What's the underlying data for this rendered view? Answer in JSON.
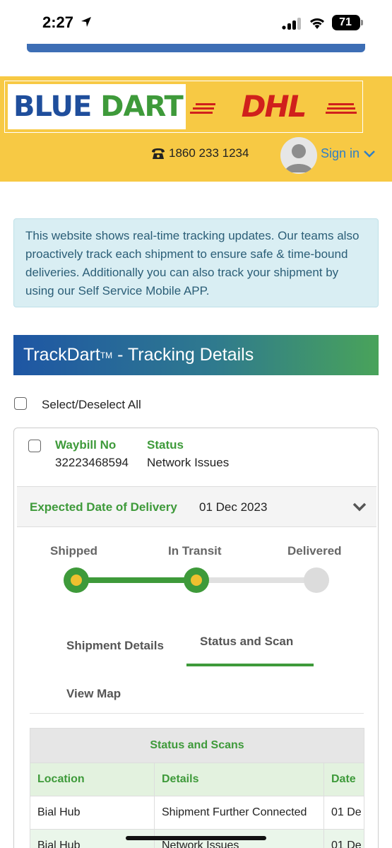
{
  "status_bar": {
    "time": "2:27",
    "battery": "71"
  },
  "header": {
    "logo_blue": "BLUE",
    "logo_dart": "DART",
    "logo_dhl": "DHL",
    "phone": "1860 233 1234",
    "signin": "Sign in"
  },
  "alert": {
    "text": "This website shows real-time tracking updates. Our teams also proactively track each shipment to ensure safe & time-bound deliveries. Additionally you can also track your shipment by using our Self Service Mobile APP."
  },
  "tracking": {
    "title": "TrackDart",
    "tm": "TM",
    "title_suffix": " - Tracking Details",
    "select_all": "Select/Deselect All",
    "waybill_label": "Waybill No",
    "waybill_value": "32223468594",
    "status_label": "Status",
    "status_value": "Network Issues",
    "edd_label": "Expected Date of Delivery",
    "edd_value": "01 Dec 2023",
    "stages": [
      "Shipped",
      "In Transit",
      "Delivered"
    ],
    "current_stage": "In Transit",
    "tabs": [
      "Shipment Details",
      "Status and Scan",
      "View Map"
    ],
    "active_tab": "Status and Scan"
  },
  "scan_table": {
    "caption": "Status and Scans",
    "columns": [
      "Location",
      "Details",
      "Date"
    ],
    "rows": [
      [
        "Bial Hub",
        "Shipment Further Connected",
        "01 De"
      ],
      [
        "Bial Hub",
        "Network Issues",
        "01 De"
      ]
    ]
  },
  "colors": {
    "brand_yellow": "#f7c944",
    "brand_green": "#3e9a3a",
    "brand_blue": "#1f4e9c",
    "dhl_red": "#d0201c",
    "link_blue": "#2f7fc6"
  }
}
